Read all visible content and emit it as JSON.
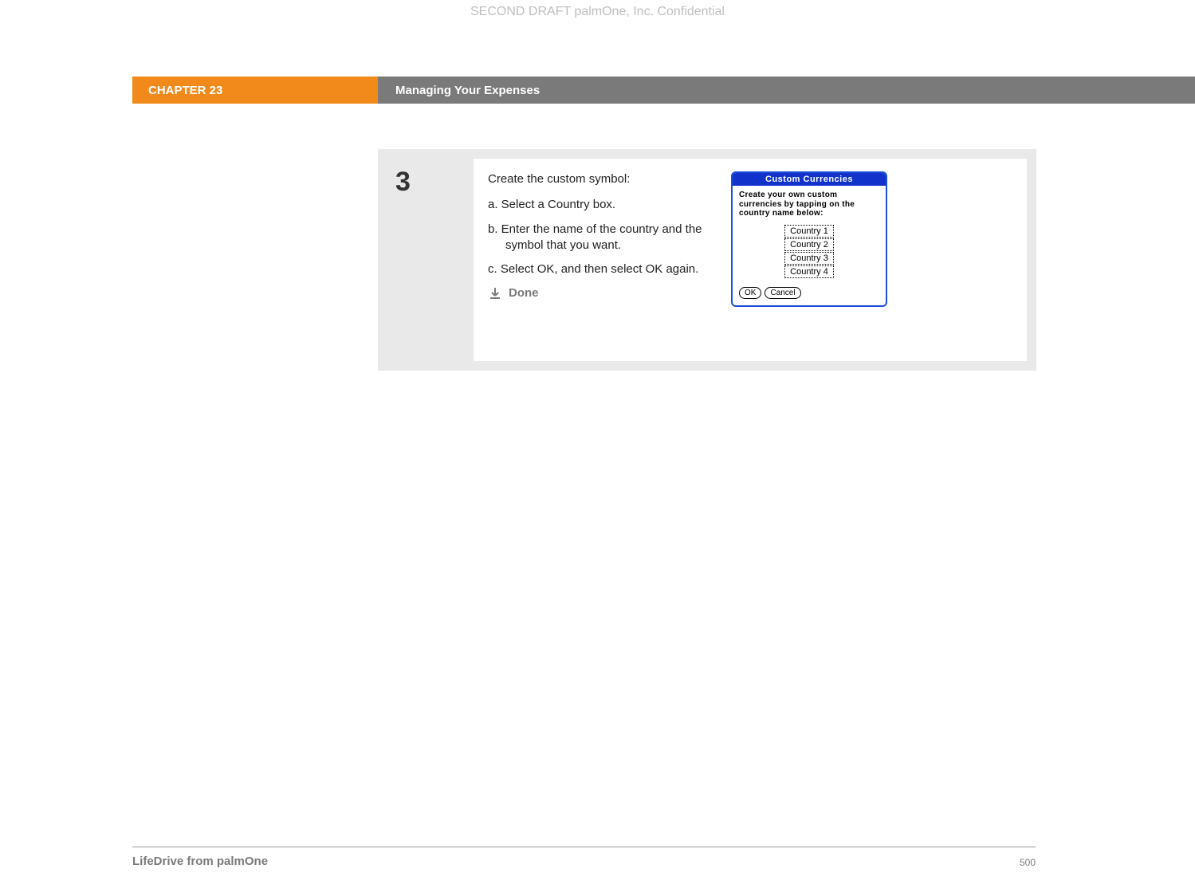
{
  "watermark": "SECOND DRAFT palmOne, Inc.  Confidential",
  "chapter": {
    "label": "CHAPTER 23",
    "title": "Managing Your Expenses"
  },
  "step": {
    "number": "3",
    "intro": "Create the custom symbol:",
    "items": [
      "a.  Select a Country box.",
      "b.  Enter the name of the country and the symbol that you want.",
      "c.  Select OK, and then select OK again."
    ],
    "done": "Done"
  },
  "palm": {
    "title": "Custom Currencies",
    "instruction": "Create your own custom currencies by tapping on the country name below:",
    "countries": [
      "Country 1",
      "Country 2",
      "Country 3",
      "Country 4"
    ],
    "ok": "OK",
    "cancel": "Cancel"
  },
  "footer": {
    "product": "LifeDrive from palmOne",
    "page": "500"
  }
}
